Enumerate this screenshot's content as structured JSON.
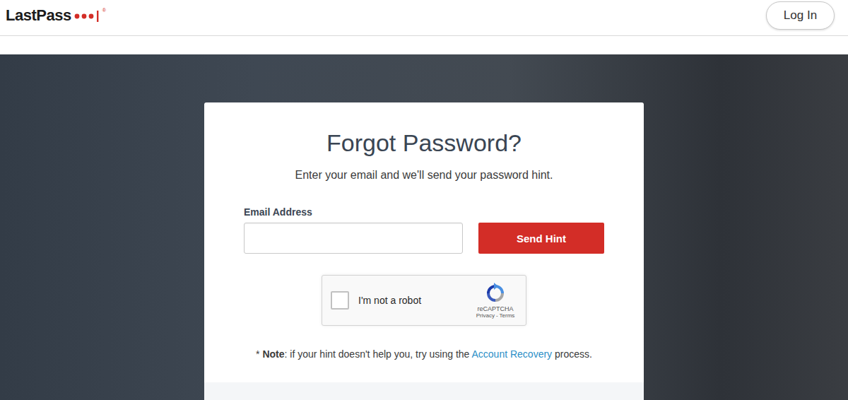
{
  "header": {
    "logo": {
      "text": "LastPass",
      "mark": "®"
    },
    "login_button": "Log In"
  },
  "card": {
    "title": "Forgot Password?",
    "subtitle": "Enter your email and we'll send your password hint.",
    "email": {
      "label": "Email Address",
      "value": ""
    },
    "button": "Send Hint",
    "captcha": {
      "label": "I'm not a robot",
      "checked": false,
      "brand": "reCAPTCHA",
      "links": [
        "Privacy",
        "Terms"
      ],
      "separator": "-"
    },
    "note": {
      "prefix": "* ",
      "strong": "Note",
      "text": ": if your hint doesn't help you, try using the ",
      "link": "Account Recovery",
      "suffix": " process."
    }
  }
}
